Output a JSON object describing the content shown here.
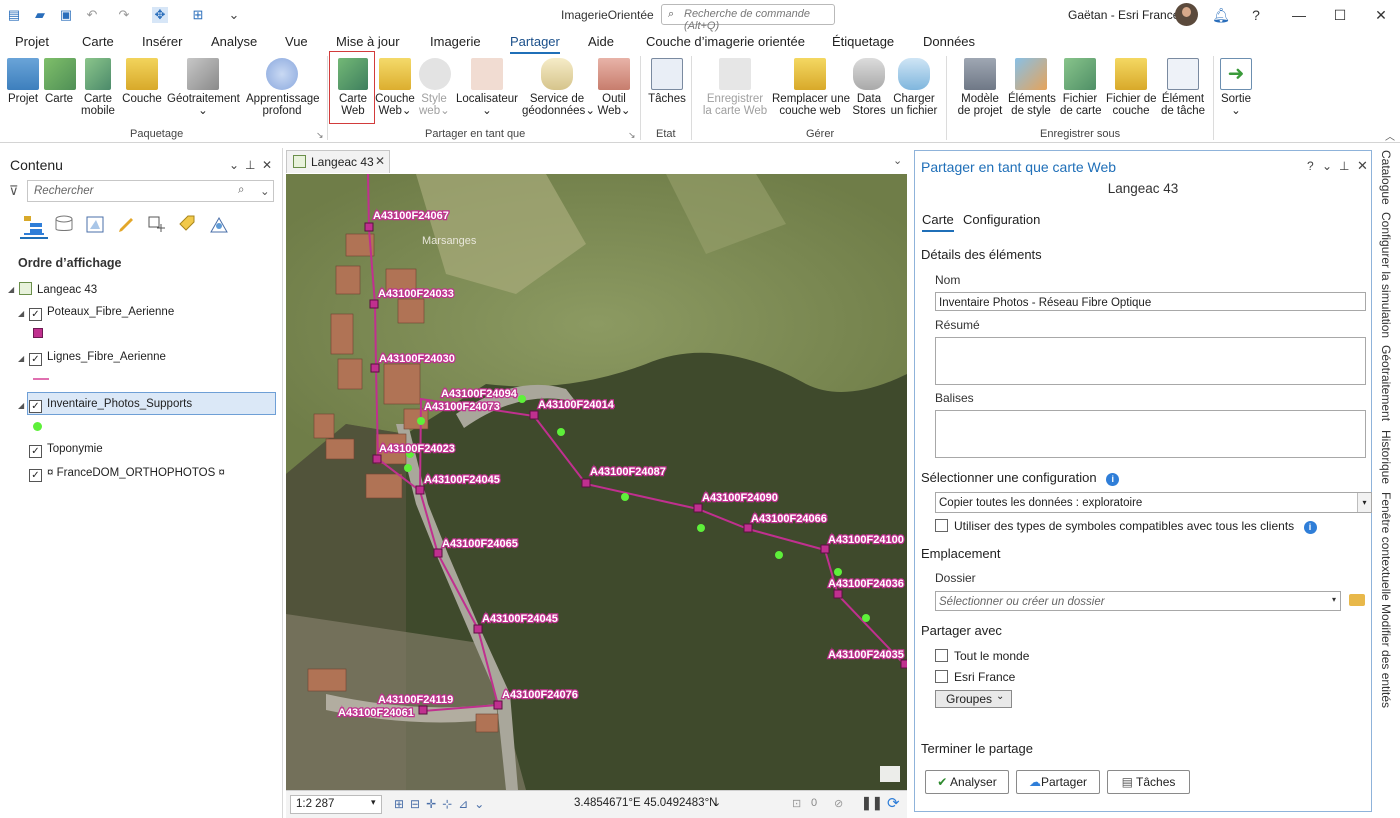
{
  "titlebar": {
    "app_title": "ImagerieOrientée",
    "command_search_placeholder": "Recherche de commande (Alt+Q)",
    "user": "Gaëtan - Esri France"
  },
  "menu": [
    "Projet",
    "Carte",
    "Insérer",
    "Analyse",
    "Vue",
    "Mise à jour",
    "Imagerie",
    "Partager",
    "Aide",
    "Couche d’imagerie orientée",
    "Étiquetage",
    "Données"
  ],
  "menu_active": "Partager",
  "ribbon": {
    "buttons": {
      "projet": "Projet",
      "carte": "Carte",
      "carte_mobile_1": "Carte",
      "carte_mobile_2": "mobile",
      "couche": "Couche",
      "geotraitement": "Géotraitement",
      "apprentissage_1": "Apprentissage",
      "apprentissage_2": "profond",
      "carte_web_1": "Carte",
      "carte_web_2": "Web",
      "couche_web_1": "Couche",
      "couche_web_2": "Web",
      "style_web_1": "Style",
      "style_web_2": "web",
      "localisateur": "Localisateur",
      "service_geo_1": "Service de",
      "service_geo_2": "géodonnées",
      "outil_web_1": "Outil",
      "outil_web_2": "Web",
      "taches": "Tâches",
      "enregistrer_web_1": "Enregistrer",
      "enregistrer_web_2": "la carte Web",
      "remplacer_1": "Remplacer une",
      "remplacer_2": "couche web",
      "data_stores_1": "Data",
      "data_stores_2": "Stores",
      "charger_1": "Charger",
      "charger_2": "un fichier",
      "modele_1": "Modèle",
      "modele_2": "de projet",
      "elements_style_1": "Éléments",
      "elements_style_2": "de style",
      "fichier_carte_1": "Fichier",
      "fichier_carte_2": "de carte",
      "fichier_couche_1": "Fichier de",
      "fichier_couche_2": "couche",
      "element_tache_1": "Élément",
      "element_tache_2": "de tâche",
      "sortie": "Sortie"
    },
    "groups": {
      "paquetage": "Paquetage",
      "partager_tant_que": "Partager en tant que",
      "etat": "Etat",
      "gerer": "Gérer",
      "enregistrer_sous": "Enregistrer sous"
    }
  },
  "contents": {
    "title": "Contenu",
    "search_placeholder": "Rechercher",
    "order_title": "Ordre d’affichage",
    "map_name": "Langeac 43",
    "layers": [
      "Poteaux_Fibre_Aerienne",
      "Lignes_Fibre_Aerienne",
      "Inventaire_Photos_Supports",
      "Toponymie",
      "¤ FranceDOM_ORTHOPHOTOS ¤"
    ]
  },
  "map": {
    "tab_title": "Langeac 43",
    "scale": "1:2 287",
    "coordinates": "3.4854671°E 45.0492483°N",
    "selection_count": "0",
    "place_label": "Marsanges",
    "labels": [
      "A43100F24067",
      "A43100F24033",
      "A43100F24030",
      "A43100F24094",
      "A43100F24073",
      "A43100F24014",
      "A43100F24023",
      "A43100F24087",
      "A43100F24045",
      "A43100F24090",
      "A43100F24066",
      "A43100F24100",
      "A43100F24065",
      "A43100F24036",
      "A43100F24045",
      "A43100F24035",
      "A43100F24119",
      "A43100F24061",
      "A43100F24076"
    ],
    "colors": {
      "line": "#c0308f",
      "pole": "#c0308f",
      "photo": "#5ef03a"
    }
  },
  "share": {
    "title": "Partager en tant que carte Web",
    "subtitle": "Langeac 43",
    "tabs": [
      "Carte",
      "Configuration"
    ],
    "details_title": "Détails des éléments",
    "name_label": "Nom",
    "name_value": "Inventaire Photos - Réseau Fibre Optique",
    "summary_label": "Résumé",
    "tags_label": "Balises",
    "config_title": "Sélectionner une configuration",
    "config_value": "Copier toutes les données : exploratoire",
    "compat_label": "Utiliser des types de symboles compatibles avec tous les clients",
    "location_title": "Emplacement",
    "folder_label": "Dossier",
    "folder_placeholder": "Sélectionner ou créer un dossier",
    "share_with_title": "Partager avec",
    "everyone": "Tout le monde",
    "org": "Esri France",
    "groups": "Groupes",
    "finish_title": "Terminer le partage",
    "analyze": "Analyser",
    "share_btn": "Partager",
    "tasks_btn": "Tâches"
  },
  "side_dock": [
    "Catalogue",
    "Configurer la simulation",
    "Géotraitement",
    "Historique",
    "Fenêtre contextuelle",
    "Modifier des entités"
  ]
}
